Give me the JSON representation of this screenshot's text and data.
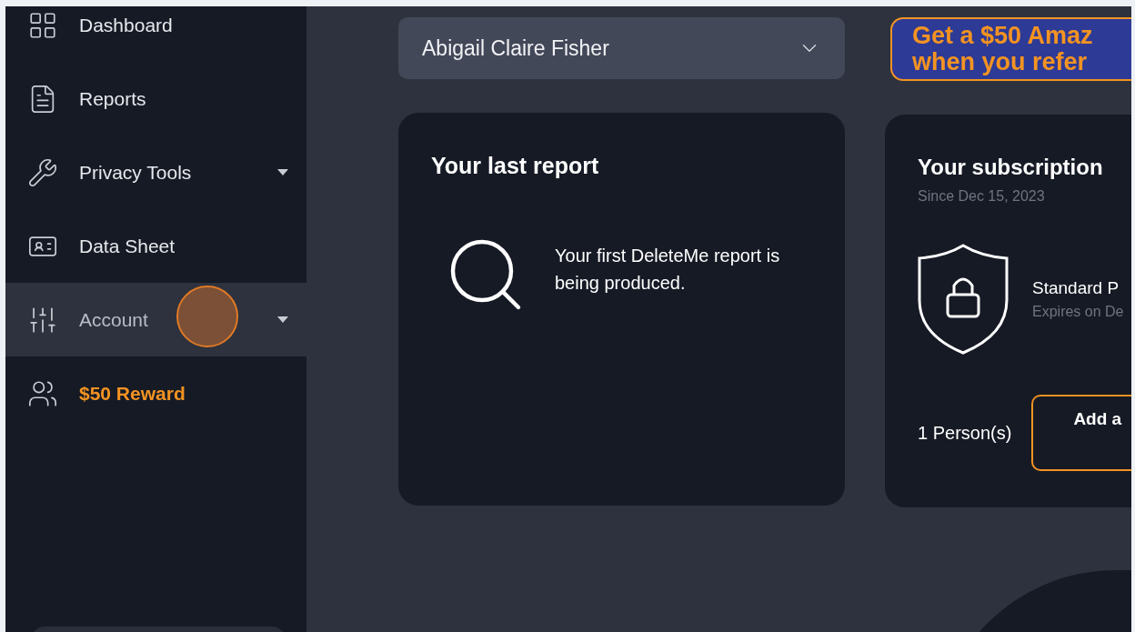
{
  "sidebar": {
    "items": [
      {
        "label": "Dashboard",
        "selected": false,
        "expandable": false,
        "kind": "normal"
      },
      {
        "label": "Reports",
        "selected": false,
        "expandable": false,
        "kind": "normal"
      },
      {
        "label": "Privacy Tools",
        "selected": false,
        "expandable": true,
        "kind": "normal"
      },
      {
        "label": "Data Sheet",
        "selected": false,
        "expandable": false,
        "kind": "normal"
      },
      {
        "label": "Account",
        "selected": true,
        "expandable": true,
        "kind": "normal"
      },
      {
        "label": "$50 Reward",
        "selected": false,
        "expandable": false,
        "kind": "reward"
      }
    ]
  },
  "profile_select": {
    "value": "Abigail Claire Fisher"
  },
  "banner": {
    "lines": [
      "Get a $50 Amaz",
      "when you refer"
    ]
  },
  "last_report": {
    "title": "Your last report",
    "message": "Your first DeleteMe report is being produced."
  },
  "subscription": {
    "title": "Your subscription",
    "since": "Since Dec 15, 2023",
    "plan": "Standard P",
    "expires": "Expires on De",
    "persons": "1 Person(s)",
    "button": "Add a"
  }
}
